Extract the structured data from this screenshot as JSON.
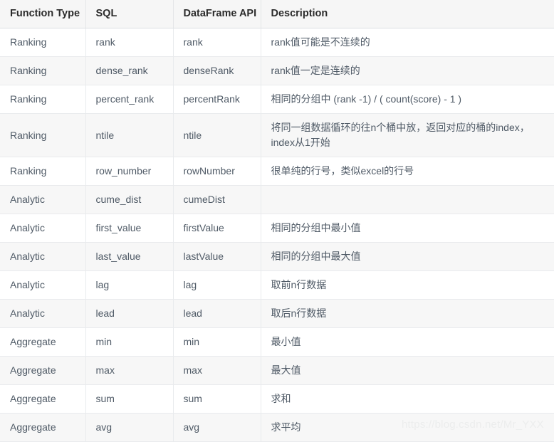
{
  "table": {
    "headers": [
      "Function Type",
      "SQL",
      "DataFrame API",
      "Description"
    ],
    "rows": [
      {
        "type": "Ranking",
        "sql": "rank",
        "api": "rank",
        "description": "rank值可能是不连续的",
        "tall": false
      },
      {
        "type": "Ranking",
        "sql": "dense_rank",
        "api": "denseRank",
        "description": "rank值一定是连续的",
        "tall": false
      },
      {
        "type": "Ranking",
        "sql": "percent_rank",
        "api": "percentRank",
        "description": "相同的分组中 (rank -1) / ( count(score) - 1 )",
        "tall": false
      },
      {
        "type": "Ranking",
        "sql": "ntile",
        "api": "ntile",
        "description": "将同一组数据循环的往n个桶中放，返回对应的桶的index，index从1开始",
        "tall": true
      },
      {
        "type": "Ranking",
        "sql": "row_number",
        "api": "rowNumber",
        "description": "很单纯的行号，类似excel的行号",
        "tall": false
      },
      {
        "type": "Analytic",
        "sql": "cume_dist",
        "api": "cumeDist",
        "description": "",
        "tall": false
      },
      {
        "type": "Analytic",
        "sql": "first_value",
        "api": "firstValue",
        "description": "相同的分组中最小值",
        "tall": false
      },
      {
        "type": "Analytic",
        "sql": "last_value",
        "api": "lastValue",
        "description": "相同的分组中最大值",
        "tall": false
      },
      {
        "type": "Analytic",
        "sql": "lag",
        "api": "lag",
        "description": "取前n行数据",
        "tall": false
      },
      {
        "type": "Analytic",
        "sql": "lead",
        "api": "lead",
        "description": "取后n行数据",
        "tall": false
      },
      {
        "type": "Aggregate",
        "sql": "min",
        "api": "min",
        "description": "最小值",
        "tall": false
      },
      {
        "type": "Aggregate",
        "sql": "max",
        "api": "max",
        "description": "最大值",
        "tall": false
      },
      {
        "type": "Aggregate",
        "sql": "sum",
        "api": "sum",
        "description": "求和",
        "tall": false
      },
      {
        "type": "Aggregate",
        "sql": "avg",
        "api": "avg",
        "description": "求平均",
        "tall": false
      }
    ]
  },
  "watermark": {
    "text": "https://blog.csdn.net/Mr_YXX"
  },
  "colors": {
    "header_bg": "#f6f6f6",
    "header_text": "#2b2b2b",
    "cell_text": "#4f5a66",
    "row_alt_bg": "#f7f7f7",
    "border": "#e9ebed",
    "watermark": "#eceded"
  }
}
